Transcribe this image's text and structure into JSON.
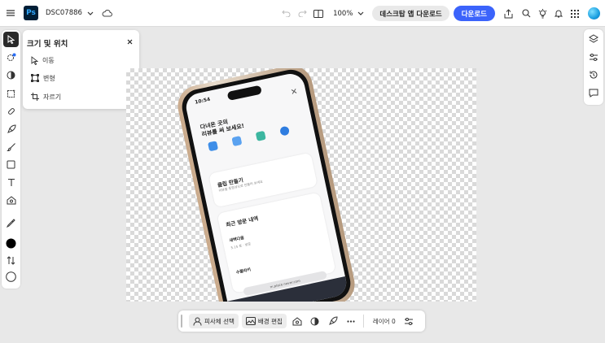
{
  "topbar": {
    "app_logo": "Ps",
    "doc_name": "DSC07886",
    "zoom": "100%",
    "desktop_app_label": "데스크탑 앱 다운로드",
    "download_label": "다운로드"
  },
  "panel": {
    "title": "크기 및 위치",
    "items": [
      {
        "label": "이동",
        "icon": "move-icon"
      },
      {
        "label": "변형",
        "icon": "transform-icon"
      },
      {
        "label": "자르기",
        "icon": "crop-icon"
      }
    ]
  },
  "canvas_image": {
    "time": "10:54",
    "heading_line1": "다녀온 곳의",
    "heading_line2": "리뷰를 써 보세요!",
    "card1_title": "클립 만들기",
    "card1_sub": "리뷰를 동영상으로 만들어 보세요",
    "card2_title": "최근 방문 내역",
    "card2_item": "새벽다움",
    "card2_sub": "5.15 토 · 방문",
    "card2_item2": "수블라키",
    "url": "m.place.naver.com"
  },
  "bottombar": {
    "select_subject_label": "피사체 선택",
    "bg_edit_label": "배경 편집",
    "layer_label": "레이어 0"
  },
  "colors": {
    "accent": "#3b63fb",
    "ps_logo_bg": "#001e36",
    "ps_logo_fg": "#31a8ff"
  }
}
